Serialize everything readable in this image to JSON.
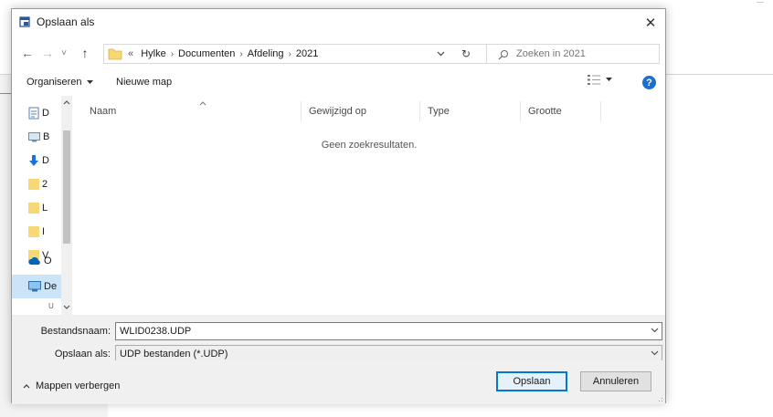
{
  "dialog": {
    "title": "Opslaan als",
    "close_glyph": "✕"
  },
  "nav": {
    "back_glyph": "←",
    "forward_glyph": "→",
    "recent_glyph": "˅",
    "up_glyph": "↑",
    "refresh_glyph": "↻",
    "breadcrumb_overflow": "«",
    "breadcrumb": [
      "Hylke",
      "Documenten",
      "Afdeling",
      "2021"
    ],
    "search_placeholder": "Zoeken in 2021"
  },
  "commandbar": {
    "organize_label": "Organiseren",
    "new_folder_label": "Nieuwe map",
    "help_label": "?"
  },
  "navpane": {
    "items": [
      {
        "icon": "document-icon",
        "label": "D"
      },
      {
        "icon": "desktop-icon",
        "label": "B"
      },
      {
        "icon": "download-icon",
        "label": "D"
      },
      {
        "icon": "folder-icon",
        "label": "2"
      },
      {
        "icon": "folder-icon",
        "label": "L"
      },
      {
        "icon": "folder-icon",
        "label": "I"
      },
      {
        "icon": "folder-icon",
        "label": "V"
      },
      {
        "icon": "onedrive-icon",
        "label": "O"
      },
      {
        "icon": "this-pc-icon",
        "label": "De"
      },
      {
        "icon": "network-icon",
        "label": "U"
      }
    ]
  },
  "columns": {
    "name": "Naam",
    "modified": "Gewijzigd op",
    "type": "Type",
    "size": "Grootte"
  },
  "empty_message": "Geen zoekresultaten.",
  "form": {
    "filename_label": "Bestandsnaam:",
    "filename_value": "WLID0238.UDP",
    "filetype_label": "Opslaan als:",
    "filetype_value": "UDP bestanden (*.UDP)"
  },
  "footer": {
    "hide_folders_label": "Mappen verbergen",
    "save_label": "Opslaan",
    "cancel_label": "Annuleren"
  },
  "colors": {
    "accent": "#0078d7",
    "folder": "#f8d775",
    "selected_row": "#cce4f7",
    "help": "#1a6fd1"
  }
}
